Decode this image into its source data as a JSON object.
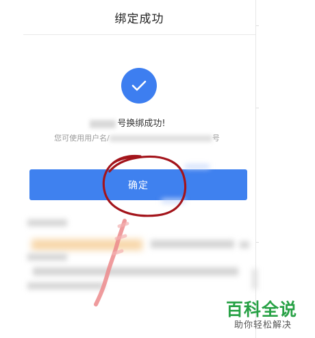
{
  "header": {
    "title": "绑定成功"
  },
  "status": {
    "icon": "check-icon",
    "message_suffix": "号换绑成功!",
    "hint_prefix": "您可使用用户名/",
    "hint_suffix": "号"
  },
  "actions": {
    "confirm_label": "确定"
  },
  "watermark": {
    "title": "百科全说",
    "subtitle": "助你轻松解决"
  },
  "colors": {
    "accent": "#3f81ef",
    "annotation": "#a3141b",
    "watermark": "#27a145"
  }
}
